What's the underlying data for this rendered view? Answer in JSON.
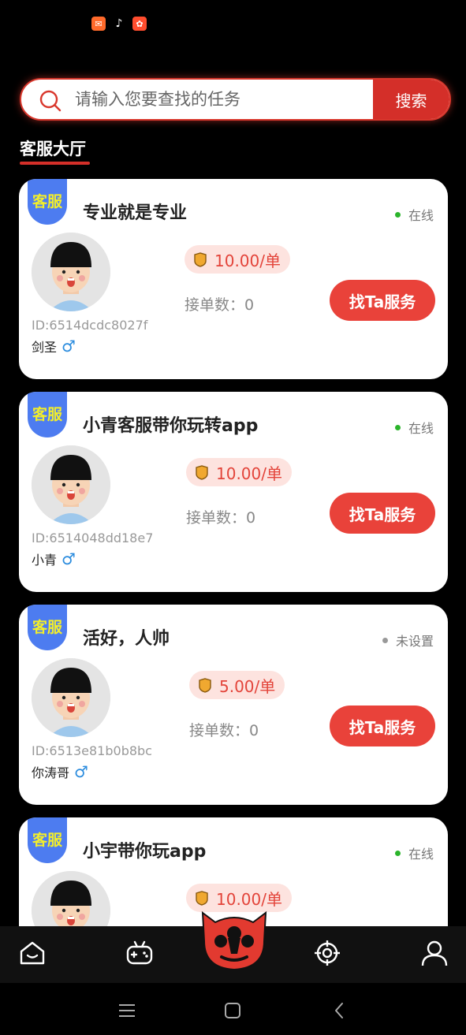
{
  "search": {
    "placeholder": "请输入您要查找的任务",
    "button_label": "搜索"
  },
  "section_title": "客服大厅",
  "cards": [
    {
      "badge": "客服",
      "title": "专业就是专业",
      "status": "在线",
      "price": "10.00/单",
      "orders": "接单数：0",
      "button": "找Ta服务",
      "id": "ID:6514dcdc8027f",
      "name": "剑圣"
    },
    {
      "badge": "客服",
      "title": "小青客服带你玩转app",
      "status": "在线",
      "price": "10.00/单",
      "orders": "接单数：0",
      "button": "找Ta服务",
      "id": "ID:6514048dd18e7",
      "name": "小青"
    },
    {
      "badge": "客服",
      "title": "活好，人帅",
      "status": "未设置",
      "price": "5.00/单",
      "orders": "接单数：0",
      "button": "找Ta服务",
      "id": "ID:6513e81b0b8bc",
      "name": "你涛哥"
    },
    {
      "badge": "客服",
      "title": "小宇带你玩app",
      "status": "在线",
      "price": "10.00/单"
    }
  ],
  "colors": {
    "accent": "#d42f29",
    "badge_bg": "#4d7cf0",
    "badge_text": "#f3ee2a",
    "online": "#2bb42b"
  },
  "nav": {
    "icons": [
      "home-icon",
      "gamepad-icon",
      "app-logo",
      "target-icon",
      "user-icon"
    ]
  }
}
